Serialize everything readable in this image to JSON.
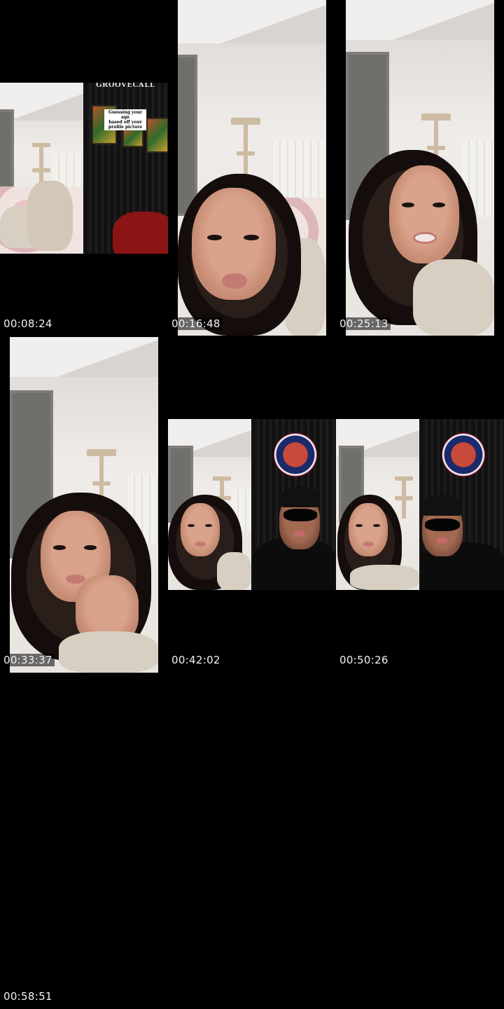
{
  "timestamps": [
    {
      "label": "00:08:24"
    },
    {
      "label": "00:16:48"
    },
    {
      "label": "00:25:13"
    },
    {
      "label": "00:33:37"
    },
    {
      "label": "00:42:02"
    },
    {
      "label": "00:50:26"
    },
    {
      "label": "00:58:51"
    }
  ],
  "frame1": {
    "sign_text": "GROOVECALL",
    "caption_lines": [
      "Guessing your age",
      "based off your",
      "profile picture"
    ]
  }
}
